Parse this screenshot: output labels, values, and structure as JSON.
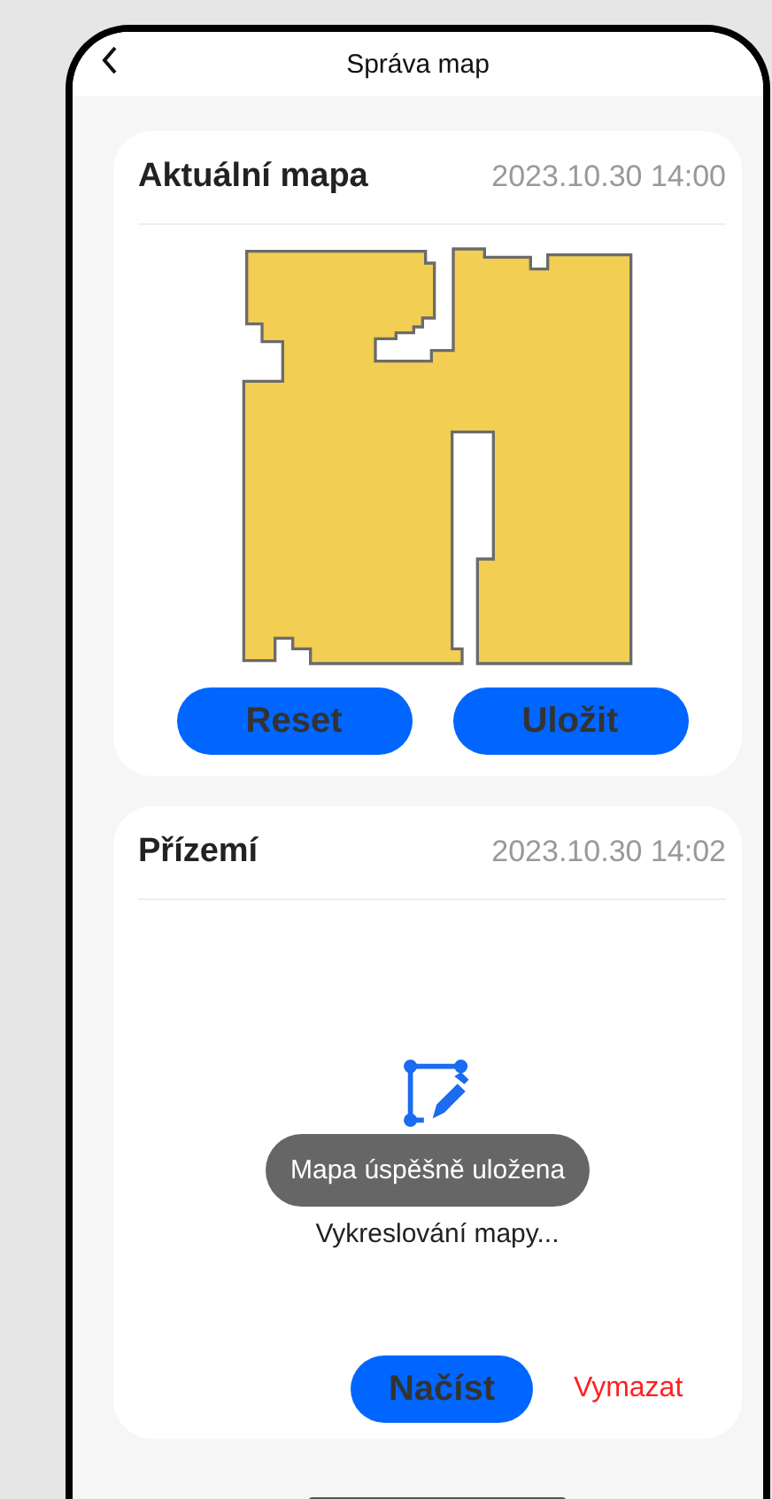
{
  "header": {
    "title": "Správa map"
  },
  "maps": [
    {
      "title": "Aktuální mapa",
      "date": "2023.10.30 14:00",
      "kind": "map",
      "buttons": [
        {
          "label": "Reset",
          "kind": "primary"
        },
        {
          "label": "Uložit",
          "kind": "primary"
        }
      ]
    },
    {
      "title": "Přízemí",
      "date": "2023.10.30 14:02",
      "kind": "drawing",
      "status": "Vykreslování mapy...",
      "buttons": [
        {
          "label": "Načíst",
          "kind": "primary"
        },
        {
          "label": "Vymazat",
          "kind": "danger"
        }
      ]
    }
  ],
  "toast": {
    "text": "Mapa úspěšně uložena"
  }
}
